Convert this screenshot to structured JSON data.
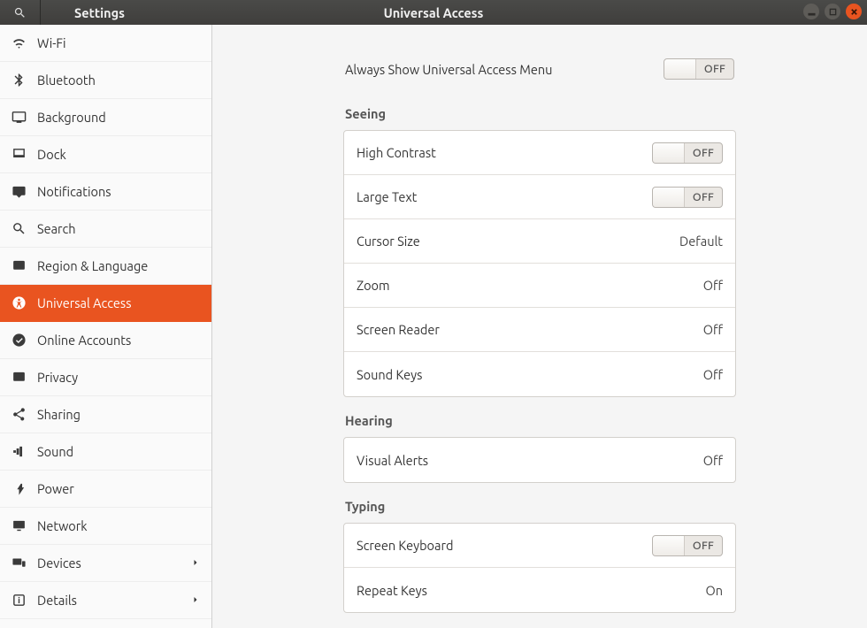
{
  "titlebar": {
    "app_title": "Settings",
    "page_title": "Universal Access"
  },
  "sidebar": {
    "items": [
      {
        "id": "wifi",
        "label": "Wi-Fi"
      },
      {
        "id": "bluetooth",
        "label": "Bluetooth"
      },
      {
        "id": "background",
        "label": "Background"
      },
      {
        "id": "dock",
        "label": "Dock"
      },
      {
        "id": "notifications",
        "label": "Notifications"
      },
      {
        "id": "search",
        "label": "Search"
      },
      {
        "id": "region",
        "label": "Region & Language"
      },
      {
        "id": "universal",
        "label": "Universal Access"
      },
      {
        "id": "online",
        "label": "Online Accounts"
      },
      {
        "id": "privacy",
        "label": "Privacy"
      },
      {
        "id": "sharing",
        "label": "Sharing"
      },
      {
        "id": "sound",
        "label": "Sound"
      },
      {
        "id": "power",
        "label": "Power"
      },
      {
        "id": "network",
        "label": "Network"
      },
      {
        "id": "devices",
        "label": "Devices",
        "chevron": true
      },
      {
        "id": "details",
        "label": "Details",
        "chevron": true
      }
    ]
  },
  "main": {
    "always_show_label": "Always Show Universal Access Menu",
    "always_show_toggle": "OFF",
    "sections": {
      "seeing": {
        "title": "Seeing",
        "rows": [
          {
            "label": "High Contrast",
            "toggle": "OFF"
          },
          {
            "label": "Large Text",
            "toggle": "OFF"
          },
          {
            "label": "Cursor Size",
            "value": "Default"
          },
          {
            "label": "Zoom",
            "value": "Off"
          },
          {
            "label": "Screen Reader",
            "value": "Off"
          },
          {
            "label": "Sound Keys",
            "value": "Off"
          }
        ]
      },
      "hearing": {
        "title": "Hearing",
        "rows": [
          {
            "label": "Visual Alerts",
            "value": "Off"
          }
        ]
      },
      "typing": {
        "title": "Typing",
        "rows": [
          {
            "label": "Screen Keyboard",
            "toggle": "OFF"
          },
          {
            "label": "Repeat Keys",
            "value": "On"
          }
        ]
      }
    }
  }
}
